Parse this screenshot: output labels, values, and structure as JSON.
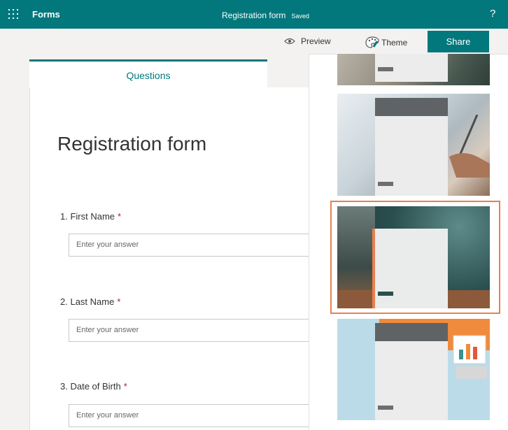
{
  "app": {
    "name": "Forms",
    "help_label": "?"
  },
  "header": {
    "form_title": "Registration form",
    "save_status": "Saved"
  },
  "commands": {
    "preview_label": "Preview",
    "theme_label": "Theme",
    "share_label": "Share"
  },
  "tabs": {
    "questions_label": "Questions"
  },
  "form": {
    "title": "Registration form",
    "questions": [
      {
        "number": "1.",
        "label": "First Name",
        "required_mark": "*",
        "placeholder": "Enter your answer"
      },
      {
        "number": "2.",
        "label": "Last Name",
        "required_mark": "*",
        "placeholder": "Enter your answer"
      },
      {
        "number": "3.",
        "label": "Date of Birth",
        "required_mark": "*",
        "placeholder": "Enter your answer"
      }
    ]
  },
  "theme_panel": {
    "selected_theme_index": 2,
    "theme_count_visible": 4
  },
  "colors": {
    "brand": "#03787c",
    "required": "#a4262c",
    "selection_border": "#e8804f"
  }
}
